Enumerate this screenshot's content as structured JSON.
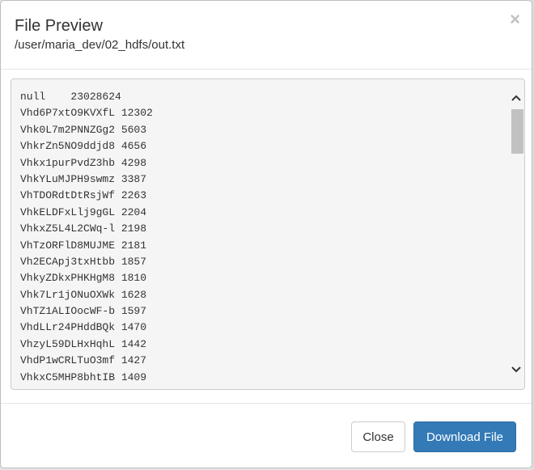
{
  "modal": {
    "title": "File Preview",
    "subtitle": "/user/maria_dev/02_hdfs/out.txt",
    "close_symbol": "×"
  },
  "file_lines": [
    "null    23028624",
    "Vhd6P7xtO9KVXfL 12302",
    "Vhk0L7m2PNNZGg2 5603",
    "VhkrZn5NO9ddjd8 4656",
    "Vhkx1purPvdZ3hb 4298",
    "VhkYLuMJPH9swmz 3387",
    "VhTDORdtDtRsjWf 2263",
    "VhkELDFxLlj9gGL 2204",
    "VhkxZ5L4L2CWq-l 2198",
    "VhTzORFlD8MUJME 2181",
    "Vh2ECApj3txHtbb 1857",
    "VhkyZDkxPHKHgM8 1810",
    "Vhk7Lr1jONuOXWk 1628",
    "VhTZ1ALIOocWF-b 1597",
    "VhdLLr24PHddBQk 1470",
    "VhzyL59DLHxHqhL 1442",
    "VhdP1wCRLTuO3mf 1427",
    "VhkxC5MHP8bhtIB 1409"
  ],
  "footer": {
    "close_label": "Close",
    "download_label": "Download File"
  },
  "colors": {
    "primary": "#337ab7",
    "content_bg": "#f5f5f5"
  }
}
